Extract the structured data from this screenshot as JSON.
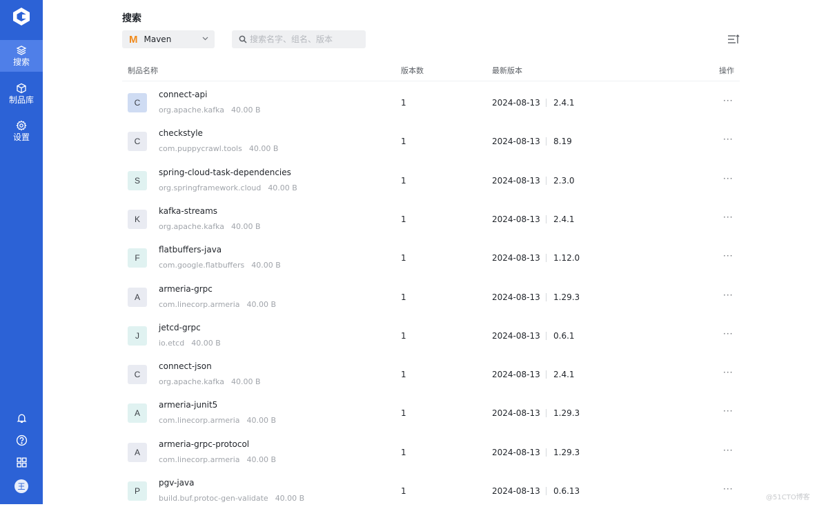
{
  "sidebar": {
    "items": [
      {
        "label": "搜索",
        "icon": "layers-icon",
        "active": true
      },
      {
        "label": "制品库",
        "icon": "cube-icon",
        "active": false
      },
      {
        "label": "设置",
        "icon": "gear-icon",
        "active": false
      }
    ],
    "bottom_icons": [
      "bell-icon",
      "help-icon",
      "grid-icon"
    ],
    "avatar_text": "王"
  },
  "header": {
    "title": "搜索",
    "repo_select": {
      "value": "Maven",
      "icon": "maven-icon"
    },
    "search": {
      "placeholder": "搜索名字、组名、版本",
      "value": ""
    },
    "sort_icon": "sort-icon"
  },
  "table": {
    "columns": [
      "制品名称",
      "版本数",
      "最新版本",
      "操作"
    ],
    "rows": [
      {
        "letter": "C",
        "badge_color": "#cfdcf3",
        "name": "connect-api",
        "group": "org.apache.kafka",
        "size": "40.00 B",
        "count": "1",
        "date": "2024-08-13",
        "version": "2.4.1",
        "more": "···"
      },
      {
        "letter": "C",
        "badge_color": "#e9ebf2",
        "name": "checkstyle",
        "group": "com.puppycrawl.tools",
        "size": "40.00 B",
        "count": "1",
        "date": "2024-08-13",
        "version": "8.19",
        "more": "···"
      },
      {
        "letter": "S",
        "badge_color": "#e0f2f1",
        "name": "spring-cloud-task-dependencies",
        "group": "org.springframework.cloud",
        "size": "40.00 B",
        "count": "1",
        "date": "2024-08-13",
        "version": "2.3.0",
        "more": "···"
      },
      {
        "letter": "K",
        "badge_color": "#e9ebf2",
        "name": "kafka-streams",
        "group": "org.apache.kafka",
        "size": "40.00 B",
        "count": "1",
        "date": "2024-08-13",
        "version": "2.4.1",
        "more": "···"
      },
      {
        "letter": "F",
        "badge_color": "#e0f2f1",
        "name": "flatbuffers-java",
        "group": "com.google.flatbuffers",
        "size": "40.00 B",
        "count": "1",
        "date": "2024-08-13",
        "version": "1.12.0",
        "more": "···"
      },
      {
        "letter": "A",
        "badge_color": "#e9ebf2",
        "name": "armeria-grpc",
        "group": "com.linecorp.armeria",
        "size": "40.00 B",
        "count": "1",
        "date": "2024-08-13",
        "version": "1.29.3",
        "more": "···"
      },
      {
        "letter": "J",
        "badge_color": "#e0f2f1",
        "name": "jetcd-grpc",
        "group": "io.etcd",
        "size": "40.00 B",
        "count": "1",
        "date": "2024-08-13",
        "version": "0.6.1",
        "more": "···"
      },
      {
        "letter": "C",
        "badge_color": "#e9ebf2",
        "name": "connect-json",
        "group": "org.apache.kafka",
        "size": "40.00 B",
        "count": "1",
        "date": "2024-08-13",
        "version": "2.4.1",
        "more": "···"
      },
      {
        "letter": "A",
        "badge_color": "#e0f2f1",
        "name": "armeria-junit5",
        "group": "com.linecorp.armeria",
        "size": "40.00 B",
        "count": "1",
        "date": "2024-08-13",
        "version": "1.29.3",
        "more": "···"
      },
      {
        "letter": "A",
        "badge_color": "#e9ebf2",
        "name": "armeria-grpc-protocol",
        "group": "com.linecorp.armeria",
        "size": "40.00 B",
        "count": "1",
        "date": "2024-08-13",
        "version": "1.29.3",
        "more": "···"
      },
      {
        "letter": "P",
        "badge_color": "#e0f2f1",
        "name": "pgv-java",
        "group": "build.buf.protoc-gen-validate",
        "size": "40.00 B",
        "count": "1",
        "date": "2024-08-13",
        "version": "0.6.13",
        "more": "···"
      }
    ]
  },
  "watermark": "@51CTO博客"
}
